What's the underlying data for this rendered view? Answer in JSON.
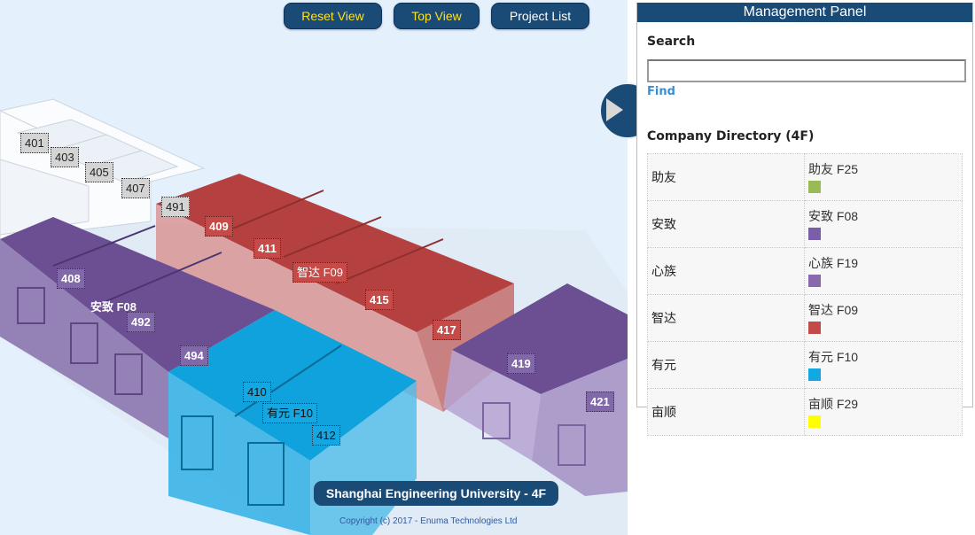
{
  "toolbar": {
    "reset_view": "Reset View",
    "top_view": "Top View",
    "project_list": "Project List"
  },
  "rooms": {
    "r401": "401",
    "r403": "403",
    "r405": "405",
    "r407": "407",
    "r491": "491",
    "r409": "409",
    "r411": "411",
    "r415": "415",
    "r417": "417",
    "r408": "408",
    "r492": "492",
    "r494": "494",
    "r419": "419",
    "r421": "421",
    "r410": "410",
    "r412": "412"
  },
  "company_labels": {
    "zhida": "智达 F09",
    "anzhi": "安致 F08",
    "youyuan": "有元 F10"
  },
  "footer": {
    "caption": "Shanghai Engineering University - 4F",
    "copyright": "Copyright (c) 2017 - Enuma Technologies Ltd"
  },
  "panel": {
    "title": "Management Panel",
    "search_label": "Search",
    "search_value": "",
    "find_label": "Find",
    "directory_title": "Company Directory (4F)",
    "directory": [
      {
        "name": "助友",
        "info": "助友 F25",
        "color": "#99bb55"
      },
      {
        "name": "安致",
        "info": "安致 F08",
        "color": "#7b5ea8"
      },
      {
        "name": "心族",
        "info": "心族 F19",
        "color": "#8a68ad"
      },
      {
        "name": "智达",
        "info": "智达 F09",
        "color": "#c24a48"
      },
      {
        "name": "有元",
        "info": "有元 F10",
        "color": "#13a7e3"
      },
      {
        "name": "亩顺",
        "info": "亩顺 F29",
        "color": "#ffff00"
      }
    ]
  },
  "colors": {
    "accent": "#1a4a76",
    "office_red": "#c24a48",
    "office_purple": "#7b5ea8",
    "office_blue": "#13a7e3"
  }
}
